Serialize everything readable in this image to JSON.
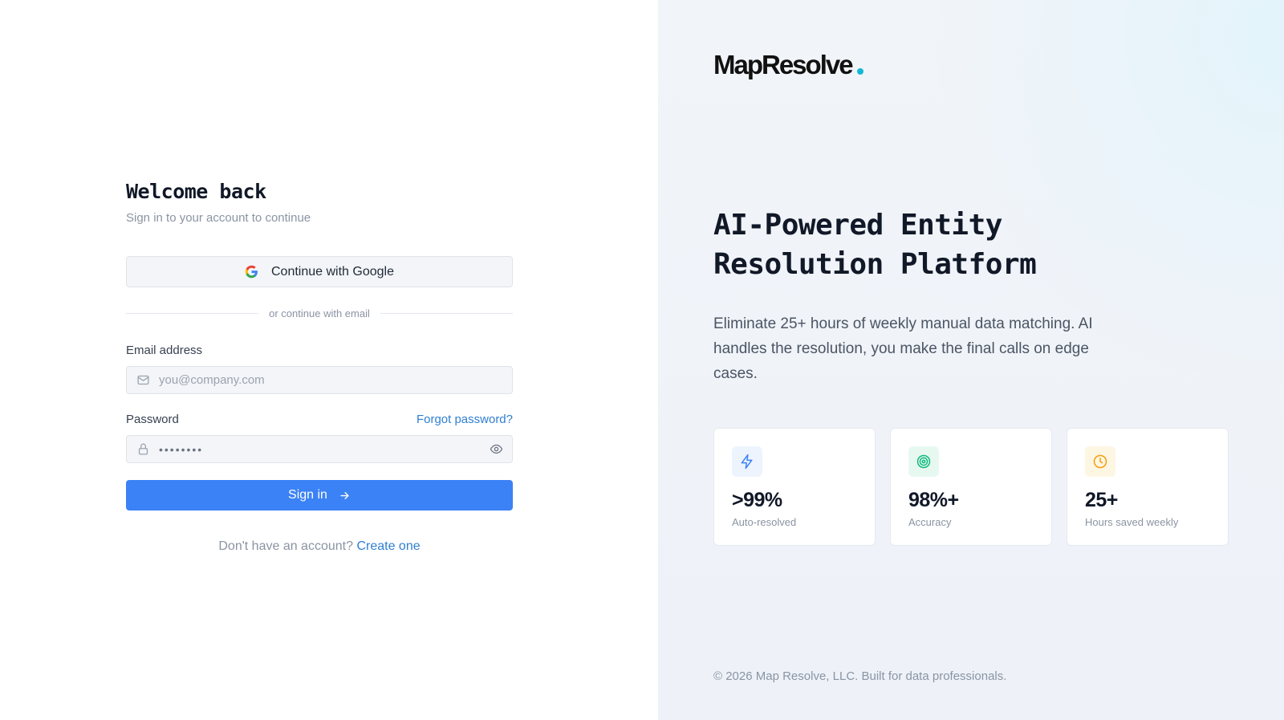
{
  "login": {
    "title": "Welcome back",
    "subtitle": "Sign in to your account to continue",
    "google_label": "Continue with Google",
    "divider_text": "or continue with email",
    "email_label": "Email address",
    "email_placeholder": "you@company.com",
    "password_label": "Password",
    "forgot_label": "Forgot password?",
    "password_value": "••••••••",
    "signin_label": "Sign in",
    "signup_prompt": "Don't have an account?",
    "signup_link": "Create one"
  },
  "brand": {
    "name": "MapResolve",
    "dot_color": "#14b8d4"
  },
  "hero": {
    "headline_line1": "AI-Powered Entity",
    "headline_line2": "Resolution Platform",
    "description": "Eliminate 25+ hours of weekly manual data matching. AI handles the resolution, you make the final calls on edge cases."
  },
  "stats": [
    {
      "icon": "lightning-icon",
      "value": ">99%",
      "caption": "Auto-resolved",
      "color": "#3b82f6"
    },
    {
      "icon": "target-icon",
      "value": "98%+",
      "caption": "Accuracy",
      "color": "#10b981"
    },
    {
      "icon": "clock-icon",
      "value": "25+",
      "caption": "Hours saved weekly",
      "color": "#f59e0b"
    }
  ],
  "footer": {
    "copyright": "© 2026 Map Resolve, LLC. Built for data professionals."
  },
  "colors": {
    "primary": "#3b82f6",
    "link": "#2f7fd1"
  }
}
